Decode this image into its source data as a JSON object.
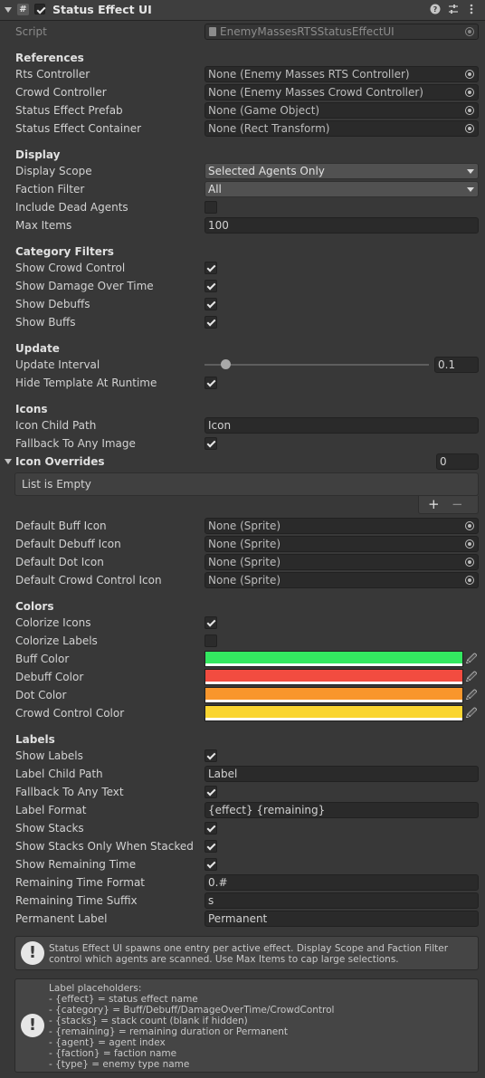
{
  "header": {
    "title": "Status Effect UI",
    "script_icon_glyph": "#",
    "icons": [
      "help-icon",
      "preset-icon",
      "more-icon"
    ]
  },
  "script": {
    "label": "Script",
    "value": "EnemyMassesRTSStatusEffectUI"
  },
  "references": {
    "title": "References",
    "rts_controller": {
      "label": "Rts Controller",
      "value": "None (Enemy Masses RTS Controller)"
    },
    "crowd_controller": {
      "label": "Crowd Controller",
      "value": "None (Enemy Masses Crowd Controller)"
    },
    "status_effect_prefab": {
      "label": "Status Effect Prefab",
      "value": "None (Game Object)"
    },
    "status_effect_container": {
      "label": "Status Effect Container",
      "value": "None (Rect Transform)"
    }
  },
  "display": {
    "title": "Display",
    "display_scope": {
      "label": "Display Scope",
      "value": "Selected Agents Only"
    },
    "faction_filter": {
      "label": "Faction Filter",
      "value": "All"
    },
    "include_dead_agents": {
      "label": "Include Dead Agents",
      "checked": false
    },
    "max_items": {
      "label": "Max Items",
      "value": "100"
    }
  },
  "category_filters": {
    "title": "Category Filters",
    "show_crowd_control": {
      "label": "Show Crowd Control",
      "checked": true
    },
    "show_damage_over_time": {
      "label": "Show Damage Over Time",
      "checked": true
    },
    "show_debuffs": {
      "label": "Show Debuffs",
      "checked": true
    },
    "show_buffs": {
      "label": "Show Buffs",
      "checked": true
    }
  },
  "update": {
    "title": "Update",
    "update_interval": {
      "label": "Update Interval",
      "value": "0.1",
      "slider_fraction": 0.1
    },
    "hide_template": {
      "label": "Hide Template At Runtime",
      "checked": true
    }
  },
  "icons": {
    "title": "Icons",
    "icon_child_path": {
      "label": "Icon Child Path",
      "value": "Icon"
    },
    "fallback_to_any_image": {
      "label": "Fallback To Any Image",
      "checked": true
    },
    "icon_overrides": {
      "label": "Icon Overrides",
      "count": "0",
      "empty_text": "List is Empty",
      "add": "+",
      "remove": "−"
    },
    "default_buff_icon": {
      "label": "Default Buff Icon",
      "value": "None (Sprite)"
    },
    "default_debuff_icon": {
      "label": "Default Debuff Icon",
      "value": "None (Sprite)"
    },
    "default_dot_icon": {
      "label": "Default Dot Icon",
      "value": "None (Sprite)"
    },
    "default_crowd_control_icon": {
      "label": "Default Crowd Control Icon",
      "value": "None (Sprite)"
    }
  },
  "colors": {
    "title": "Colors",
    "colorize_icons": {
      "label": "Colorize Icons",
      "checked": true
    },
    "colorize_labels": {
      "label": "Colorize Labels",
      "checked": false
    },
    "buff_color": {
      "label": "Buff Color",
      "color": "#33e860"
    },
    "debuff_color": {
      "label": "Debuff Color",
      "color": "#f24c40"
    },
    "dot_color": {
      "label": "Dot Color",
      "color": "#f9962c"
    },
    "crowd_control_color": {
      "label": "Crowd Control Color",
      "color": "#fad530"
    }
  },
  "labels": {
    "title": "Labels",
    "show_labels": {
      "label": "Show Labels",
      "checked": true
    },
    "label_child_path": {
      "label": "Label Child Path",
      "value": "Label"
    },
    "fallback_to_any_text": {
      "label": "Fallback To Any Text",
      "checked": true
    },
    "label_format": {
      "label": "Label Format",
      "value": "{effect} {remaining}"
    },
    "show_stacks": {
      "label": "Show Stacks",
      "checked": true
    },
    "show_stacks_only_when_stacked": {
      "label": "Show Stacks Only When Stacked",
      "checked": true
    },
    "show_remaining_time": {
      "label": "Show Remaining Time",
      "checked": true
    },
    "remaining_time_format": {
      "label": "Remaining Time Format",
      "value": "0.#"
    },
    "remaining_time_suffix": {
      "label": "Remaining Time Suffix",
      "value": "s"
    },
    "permanent_label": {
      "label": "Permanent Label",
      "value": "Permanent"
    }
  },
  "help": {
    "info": "Status Effect UI spawns one entry per active effect. Display Scope and Faction Filter control which agents are scanned. Use Max Items to cap large selections.",
    "placeholders": "Label placeholders:\n- {effect} = status effect name\n- {category} = Buff/Debuff/DamageOverTime/CrowdControl\n- {stacks} = stack count (blank if hidden)\n- {remaining} = remaining duration or Permanent\n- {agent} = agent index\n- {faction} = faction name\n- {type} = enemy type name",
    "icon_glyph": "!"
  }
}
